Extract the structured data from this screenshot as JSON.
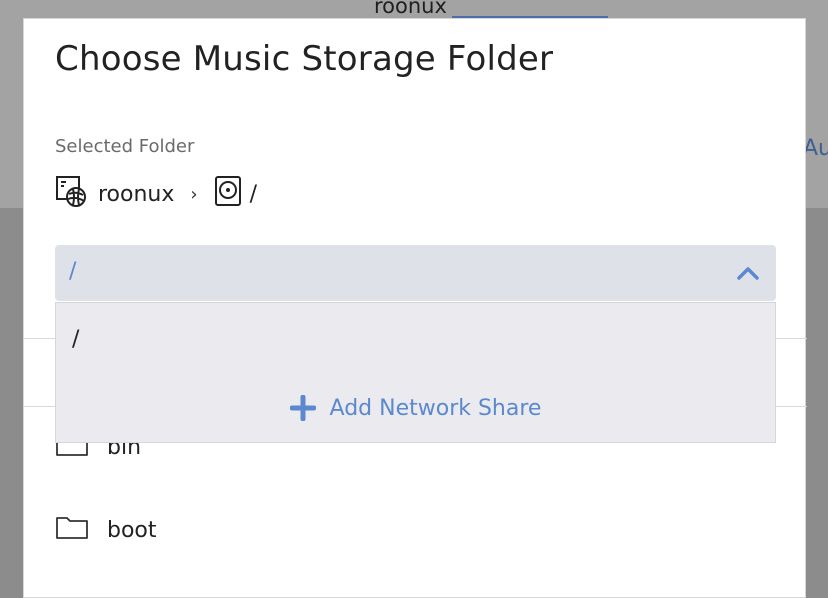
{
  "background": {
    "host_name": "roonux",
    "right_text": "Au"
  },
  "dialog": {
    "title": "Choose Music Storage Folder",
    "selected_label": "Selected Folder",
    "breadcrumb": [
      {
        "icon": "roon-server-icon",
        "label": "roonux"
      },
      {
        "icon": "hard-drive-icon",
        "label": "/"
      }
    ],
    "breadcrumb_separator": "›",
    "dropdown": {
      "selected_value": "/",
      "expanded": true,
      "options": [
        "/"
      ],
      "add_network_share": "Add Network Share"
    },
    "folders": [
      {
        "icon": "folder-icon",
        "name": "bin"
      },
      {
        "icon": "folder-icon",
        "name": "boot"
      }
    ]
  },
  "colors": {
    "accent": "#5b88cf",
    "select_bg": "#dfe1e8",
    "menu_bg": "#ebebef"
  }
}
